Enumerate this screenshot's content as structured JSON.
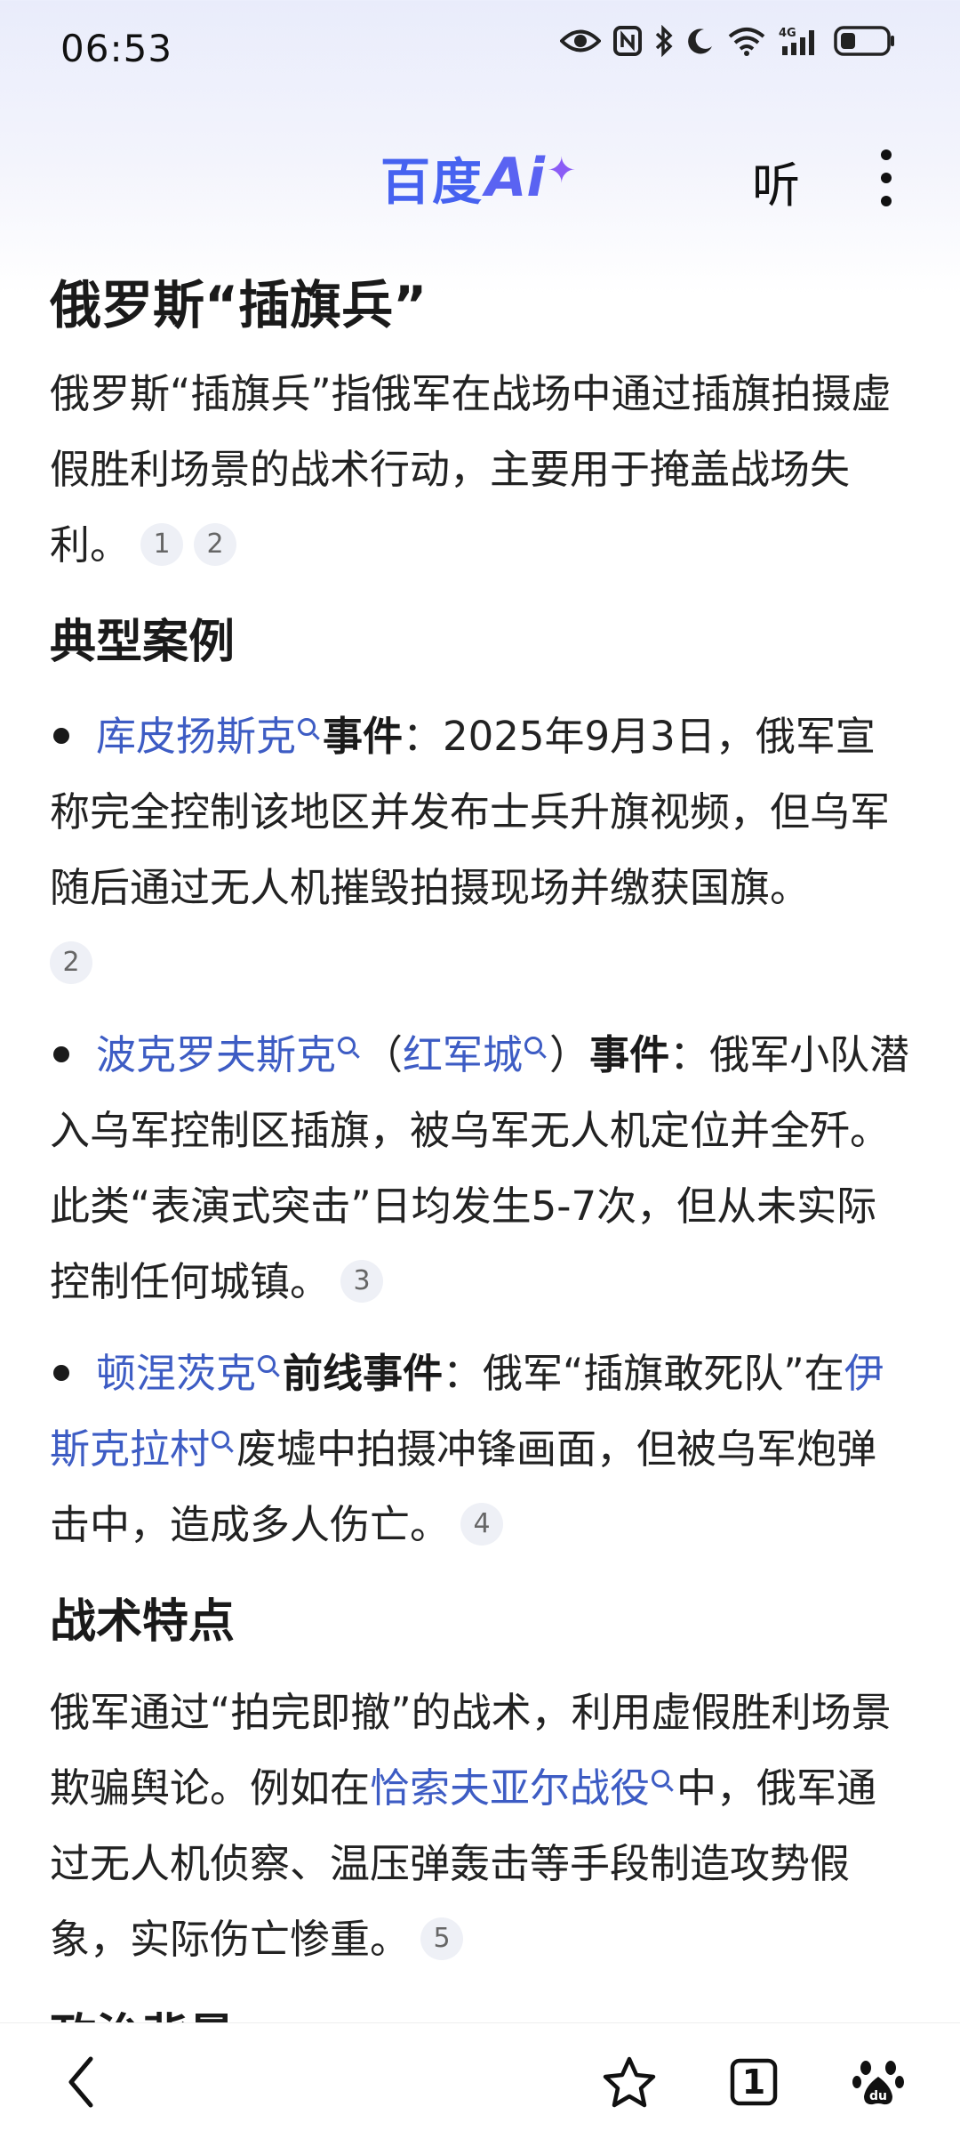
{
  "status_bar": {
    "time": "06:53",
    "icons": [
      "eye-icon",
      "nfc-icon",
      "bluetooth-icon",
      "moon-icon",
      "wifi-icon",
      "signal-4g-icon",
      "battery-icon"
    ],
    "network": "4G"
  },
  "header": {
    "logo_text": "百度",
    "logo_ai": "Ai",
    "logo_star": "✦",
    "listen_label": "听",
    "more_icon": "more-vertical-icon",
    "brand_color": "#4662f0"
  },
  "article": {
    "title": "俄罗斯“插旗兵”",
    "intro": {
      "text": "俄罗斯“插旗兵”指俄军在战场中通过插旗拍摄虚假胜利场景的战术行动，主要用于掩盖战场失利。",
      "cites": [
        "1",
        "2"
      ]
    },
    "section1_title": "典型案例",
    "cases": [
      {
        "link1": "库皮扬斯克",
        "strong": "事件",
        "text": "：2025年9月3日，俄军宣称完全控制该地区并发布士兵升旗视频，但乌军随后通过无人机摧毁拍摄现场并缴获国旗。",
        "cite": "2"
      },
      {
        "link1": "波克罗夫斯克",
        "paren_open": "（",
        "link2": "红军城",
        "paren_close": "）",
        "strong": "事件",
        "text": "：俄军小队潜入乌军控制区插旗，被乌军无人机定位并全歼。此类“表演式突击”日均发生5-7次，但从未实际控制任何城镇。",
        "cite": "3"
      },
      {
        "link1": "顿涅茨克",
        "strong": "前线事件",
        "text_a": "：俄军“插旗敢死队”在",
        "link2": "伊斯克拉村",
        "text_b": "废墟中拍摄冲锋画面，但被乌军炮弹击中，造成多人伤亡。",
        "cite": "4"
      }
    ],
    "section2_title": "战术特点",
    "tactics": {
      "text_a": "俄军通过“拍完即撤”的战术，利用虚假胜利场景欺骗舆论。例如在",
      "link": "恰索夫亚尔战役",
      "text_b": "中，俄军通过无人机侦察、温压弹轰击等手段制造攻势假象，实际伤亡惨重。",
      "cite": "5"
    },
    "section3_title_partial": "政治背景"
  },
  "bottom_nav": {
    "tab_count": "1",
    "icons": [
      "back-icon",
      "star-icon",
      "tabs-icon",
      "baidu-paw-icon"
    ]
  },
  "colors": {
    "link": "#3d5cc4",
    "text": "#222222",
    "cite_bg": "#eef0f6"
  }
}
